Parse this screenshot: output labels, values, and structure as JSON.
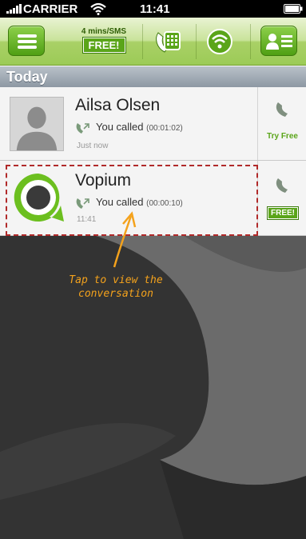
{
  "status_bar": {
    "carrier": "CARRIER",
    "time": "11:41"
  },
  "toolbar": {
    "promo_line": "4 mins/SMS",
    "promo_badge": "FREE!",
    "icons": [
      "menu-icon",
      "keypad-icon",
      "wifi-call-icon",
      "contacts-icon"
    ]
  },
  "section": {
    "title": "Today"
  },
  "calls": [
    {
      "name": "Ailsa Olsen",
      "status": "You called",
      "duration": "(00:01:02)",
      "time": "Just now",
      "action": "Try Free"
    },
    {
      "name": "Vopium",
      "status": "You called",
      "duration": "(00:00:10)",
      "time": "11:41",
      "action": "FREE!"
    }
  ],
  "hint": {
    "line1": "Tap to view the",
    "line2": "conversation"
  },
  "colors": {
    "accent_green": "#5aa519",
    "highlight_dash": "#b12a2a",
    "hint_orange": "#f4a21c",
    "background_dark": "#343434"
  }
}
